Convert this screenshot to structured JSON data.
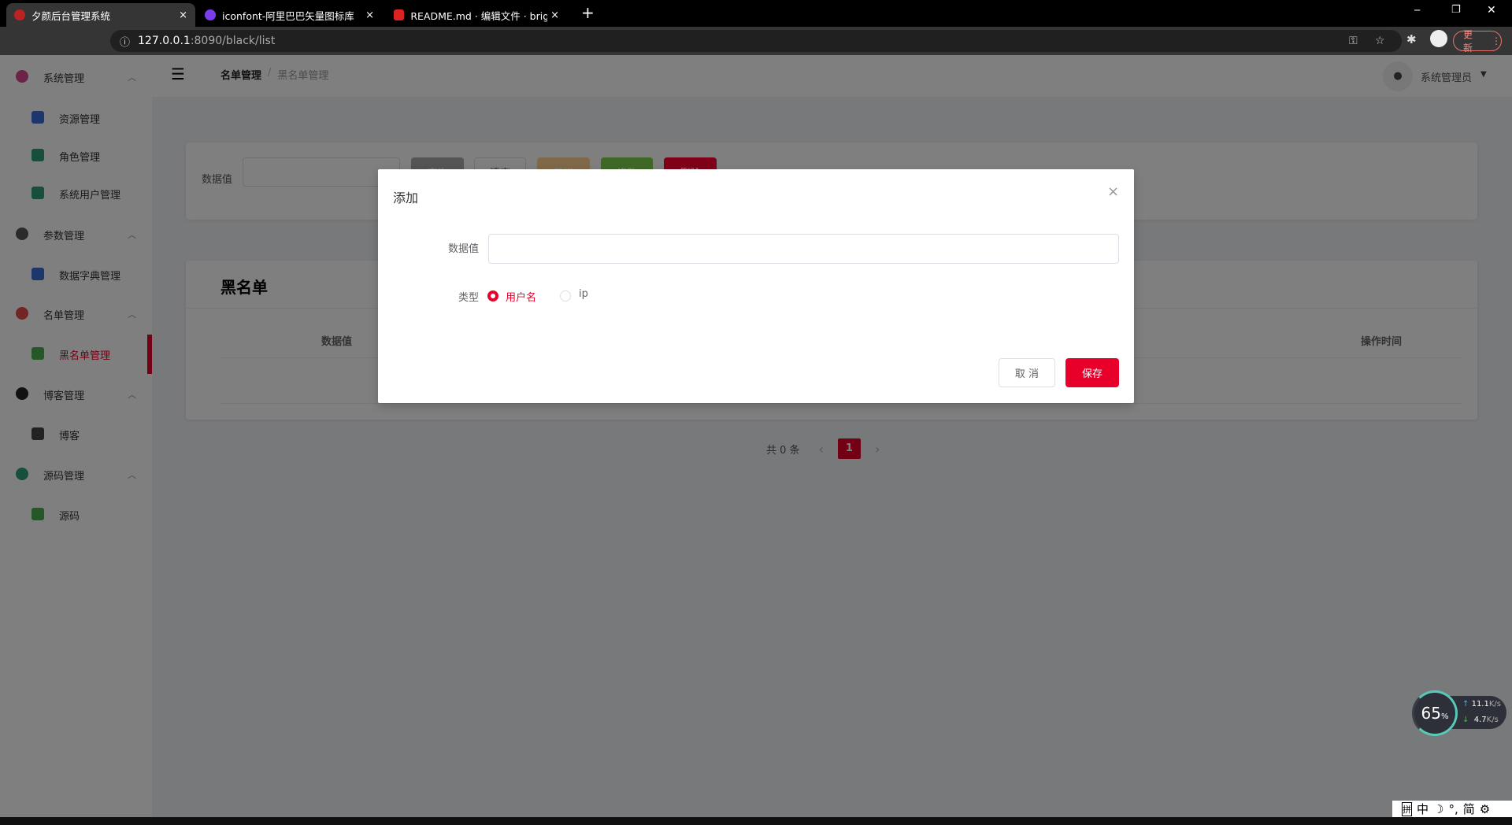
{
  "browser": {
    "tabs": [
      {
        "title": "夕颜后台管理系统",
        "active": true
      },
      {
        "title": "iconfont-阿里巴巴矢量图标库",
        "active": false
      },
      {
        "title": "README.md · 编辑文件 · bright",
        "active": false
      }
    ],
    "new_tab": "+",
    "close": "×",
    "url_host": "127.0.0.1",
    "url_rest": ":8090/black/list",
    "update_label": "更新",
    "window_controls": {
      "minimize": "─",
      "restore": "❐",
      "close": "✕"
    }
  },
  "sidebar": {
    "items": [
      {
        "label": "系统管理",
        "level": 1,
        "icon": "gear-icon",
        "color": "#d8478f"
      },
      {
        "label": "资源管理",
        "level": 2,
        "icon": "paper-plane-icon",
        "color": "#3a6fd8"
      },
      {
        "label": "角色管理",
        "level": 2,
        "icon": "viking-helmet-icon",
        "color": "#2e9e7a"
      },
      {
        "label": "系统用户管理",
        "level": 2,
        "icon": "user-icon",
        "color": "#2e9e7a"
      },
      {
        "label": "参数管理",
        "level": 1,
        "icon": "send-icon",
        "color": "#555555"
      },
      {
        "label": "数据字典管理",
        "level": 2,
        "icon": "book-icon",
        "color": "#3a6fd8"
      },
      {
        "label": "名单管理",
        "level": 1,
        "icon": "list-icon",
        "color": "#e24a4a"
      },
      {
        "label": "黑名单管理",
        "level": 2,
        "icon": "user-block-icon",
        "color": "#4caf50",
        "active": true
      },
      {
        "label": "博客管理",
        "level": 1,
        "icon": "edit-icon",
        "color": "#222222"
      },
      {
        "label": "博客",
        "level": 2,
        "icon": "blog-icon",
        "color": "#444444"
      },
      {
        "label": "源码管理",
        "level": 1,
        "icon": "code-icon",
        "color": "#2e9e7a"
      },
      {
        "label": "源码",
        "level": 2,
        "icon": "source-icon",
        "color": "#4caf50"
      }
    ],
    "accent": "#e8002a"
  },
  "header": {
    "breadcrumb": [
      "名单管理",
      "黑名单管理"
    ],
    "separator": "/",
    "user": "系统管理员"
  },
  "search": {
    "label": "数据值",
    "value": "",
    "buttons": [
      {
        "label": "查询",
        "color": "#a9aaad"
      },
      {
        "label": "清空",
        "color": "#ffffff"
      },
      {
        "label": "新增",
        "color": "#ffd392"
      },
      {
        "label": "修改",
        "color": "#7ed14c"
      },
      {
        "label": "删除",
        "color": "#ff0030"
      }
    ]
  },
  "table": {
    "title": "黑名单",
    "columns": [
      "数据值",
      "操作时间"
    ],
    "rows": []
  },
  "pagination": {
    "total": "共 0 条",
    "current": "1",
    "prev": "‹",
    "next": "›"
  },
  "modal": {
    "title": "添加",
    "close": "×",
    "fields": {
      "value_label": "数据值",
      "value": "",
      "type_label": "类型",
      "options": [
        {
          "label": "用户名",
          "selected": true
        },
        {
          "label": "ip",
          "selected": false
        }
      ]
    },
    "cancel": "取 消",
    "save": "保存"
  },
  "widget": {
    "cpu": "65",
    "unit": "%",
    "up": "11.1",
    "down": "4.7",
    "rate_unit": "K/s"
  },
  "ime": [
    "拼",
    "中",
    "☽",
    "°,",
    "简",
    "⚙"
  ]
}
